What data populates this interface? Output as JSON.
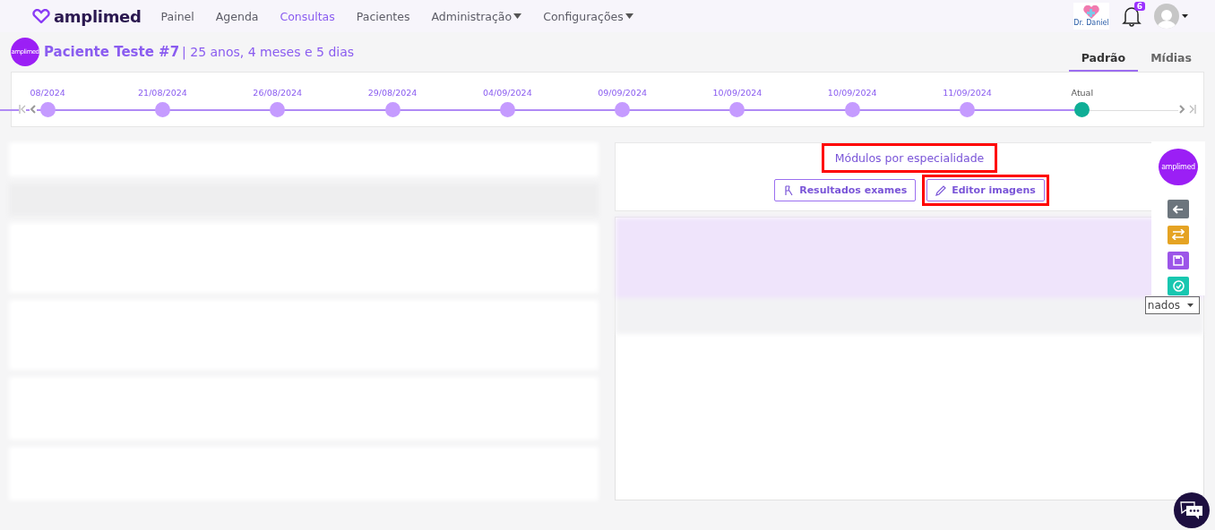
{
  "nav": {
    "brand": "amplimed",
    "items": [
      {
        "label": "Painel",
        "selected": false,
        "dropdown": false
      },
      {
        "label": "Agenda",
        "selected": false,
        "dropdown": false
      },
      {
        "label": "Consultas",
        "selected": true,
        "dropdown": false
      },
      {
        "label": "Pacientes",
        "selected": false,
        "dropdown": false
      },
      {
        "label": "Administração",
        "selected": false,
        "dropdown": true
      },
      {
        "label": "Configurações",
        "selected": false,
        "dropdown": true
      }
    ],
    "clinic_logo_text": "Dr. Daniel",
    "notifications": "6"
  },
  "patient": {
    "avatar_text": "amplimed",
    "name": "Paciente Teste #7",
    "age": "| 25 anos, 4 meses e 5 dias"
  },
  "view_tabs": [
    {
      "label": "Padrão",
      "selected": true
    },
    {
      "label": "Mídias",
      "selected": false
    }
  ],
  "timeline": [
    {
      "label": "08/2024",
      "current": false
    },
    {
      "label": "21/08/2024",
      "current": false
    },
    {
      "label": "26/08/2024",
      "current": false
    },
    {
      "label": "29/08/2024",
      "current": false
    },
    {
      "label": "04/09/2024",
      "current": false
    },
    {
      "label": "09/09/2024",
      "current": false
    },
    {
      "label": "10/09/2024",
      "current": false
    },
    {
      "label": "10/09/2024",
      "current": false
    },
    {
      "label": "11/09/2024",
      "current": false
    },
    {
      "label": "Atual",
      "current": true
    }
  ],
  "modules": {
    "title": "Módulos por especialidade",
    "highlighted": true,
    "buttons": [
      {
        "kind": "exams",
        "label": "Resultados exames",
        "highlighted": false
      },
      {
        "kind": "image",
        "label": "Editor imagens",
        "highlighted": true
      }
    ]
  },
  "documents": {
    "dropdown": "nados"
  },
  "side_actions": [
    {
      "kind": "logo",
      "text": "amplimed"
    },
    {
      "kind": "back"
    },
    {
      "kind": "swap"
    },
    {
      "kind": "save"
    },
    {
      "kind": "check"
    }
  ]
}
